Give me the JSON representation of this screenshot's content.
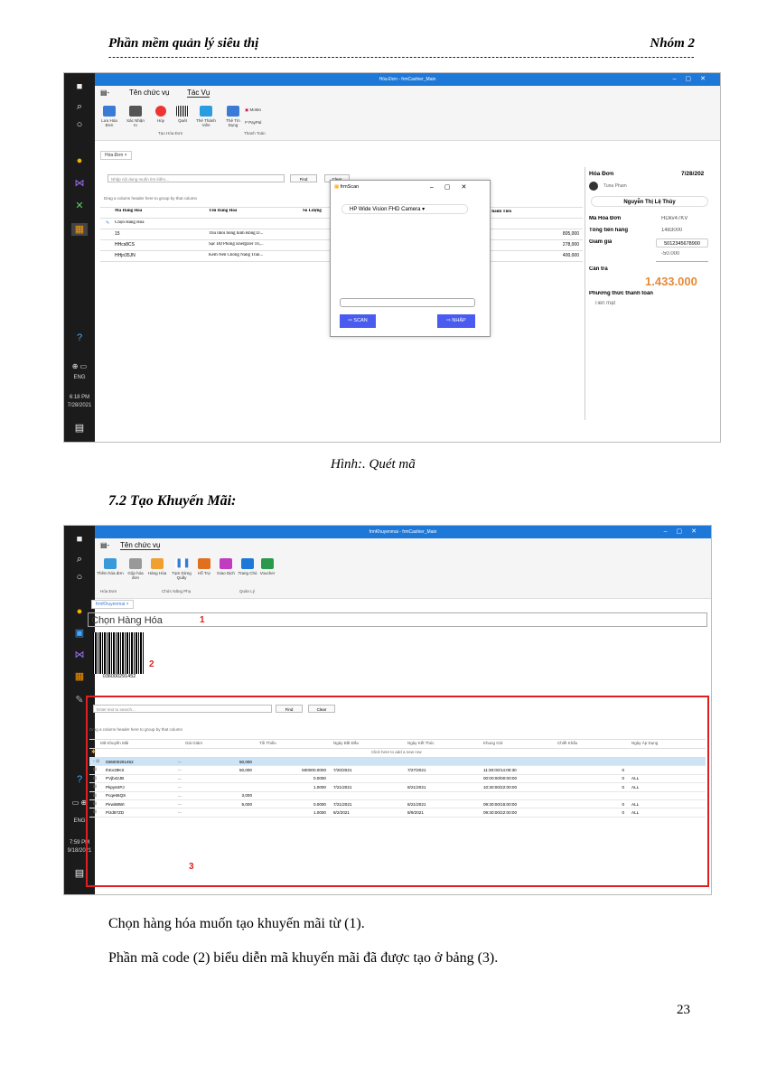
{
  "header": {
    "left": "Phần mềm quản lý siêu thị",
    "right": "Nhóm 2"
  },
  "fig1": {
    "taskbar": {
      "lang": "ENG",
      "time": "6:18 PM",
      "date": "7/28/2021"
    },
    "title": "Hóa Đơn - frmCashier_Main",
    "tabs": [
      "Tên chức vụ",
      "Tác Vụ"
    ],
    "buttons": [
      "Lưu Hóa Đơn",
      "Xác Nhận In",
      "Hủy",
      "Quét",
      "Thẻ Thành Viên",
      "Thẻ Tín Dụng",
      "MoMo",
      "PayPal"
    ],
    "groups": [
      "Tạo Hóa Đơn",
      "Thanh Toán"
    ],
    "doc_tab": "Hóa Đơn",
    "search_placeholder": "Nhập nội dung muốn tìm kiếm...",
    "find": "Find",
    "clear": "Clear",
    "group_hint": "Drag a column header here to group by that column",
    "columns": [
      "Mã Hàng Hóa",
      "Tên Hàng Hóa",
      "Số Lượng",
      "Thành Tiền"
    ],
    "rows": [
      {
        "code": "Chọn Hàng Hóa",
        "name": "",
        "total": ""
      },
      {
        "code": "15",
        "name": "Thú nhồi bông hình Rồng D...",
        "total": "805,000"
      },
      {
        "code": "HHcs8CS",
        "name": "Sạc Dự Phòng Energizer 10,...",
        "total": "278,000"
      },
      {
        "code": "HHjn35JN",
        "name": "Kem Nền Chống Nắng Tran...",
        "total": "400,000"
      }
    ],
    "scan": {
      "title": "frmScan",
      "camera": "HP Wide Vision FHD Camera",
      "scan_btn": "SCAN",
      "enter_btn": "NHẬP"
    },
    "invoice": {
      "label": "Hóa Đơn",
      "date": "7/28/202",
      "user": "Tuna Phạm",
      "customer": "Nguyễn Thị Lệ Thủy",
      "code_label": "Mã Hóa Đơn",
      "code": "HDkv47KV",
      "sum_label": "Tổng tiền hàng",
      "sum": "1483000",
      "disc_label": "Giảm giá",
      "disc_code": "5012345678900",
      "disc": "-50.000",
      "pay_label": "Cần trả",
      "pay": "1.433.000",
      "method_label": "Phương thức thanh toán",
      "method": "Tiền mặt"
    }
  },
  "caption1": "Hình:. Quét mã",
  "section": "7.2 Tạo Khuyến Mãi:",
  "fig2": {
    "taskbar": {
      "lang": "ENG",
      "time": "7:59 PM",
      "date": "9/18/2021"
    },
    "title": "frmKhuyenmai - frmCashier_Main",
    "tab": "Tên chức vụ",
    "buttons": [
      "Thêm hóa đơn",
      "Gộp hóa đơn",
      "Hàng Hóa",
      "Tạm Dừng Quầy",
      "Hỗ Trợ",
      "Giao Dịch",
      "Trang Chủ",
      "Voucher"
    ],
    "groups": [
      "Hóa Đơn",
      "Chức Năng Phụ",
      "Quản Lý"
    ],
    "doc_tab": "frmKhuyenmai",
    "combo": "Chọn Hàng Hóa",
    "barcode": "036000291452",
    "marks": [
      "1",
      "2",
      "3"
    ],
    "search_placeholder": "Enter text to search...",
    "find": "Find",
    "clear": "Clear",
    "group_hint": "Drag a column header here to group by that column",
    "columns": [
      "Mã Khuyến Mãi",
      "Giá Giảm",
      "Tối Thiểu",
      "Ngày Bắt Đầu",
      "Ngày Kết Thúc",
      "Khung Giờ",
      "Chiết Khấu",
      "Ngày Áp Dụng"
    ],
    "new_row": "Click here to add a new row",
    "rows": [
      [
        "036000291452",
        "50,000",
        "",
        "",
        "",
        "",
        "",
        ""
      ],
      [
        "IhKv29KS",
        "50,000",
        "500000.0000",
        "7/20/2021",
        "7/27/2021",
        "11:30:00/14:00:30",
        "0",
        ""
      ],
      [
        "PVjb42JB",
        "",
        "0.0000",
        "",
        "",
        "00:00:00/00:00:00",
        "0",
        "ALL"
      ],
      [
        "Pkpy64PJ",
        "",
        "1.0000",
        "7/21/2021",
        "8/21/2021",
        "10:30:00/22:00:00",
        "0",
        "ALL"
      ],
      [
        "Pcqe66QS",
        "3,000",
        "",
        "",
        "",
        "",
        "",
        ""
      ],
      [
        "Pirwi88WI",
        "9,000",
        "0.0000",
        "7/21/2021",
        "8/21/2021",
        "09:30:00/15:00:00",
        "0",
        "ALL"
      ],
      [
        "Pizd97ZD",
        "",
        "1.0000",
        "8/2/2021",
        "8/9/2021",
        "09:30:00/22:00:00",
        "0",
        "ALL"
      ]
    ]
  },
  "para1": "Chọn hàng hóa muốn tạo khuyến mãi từ (1).",
  "para2": "Phần mã code (2) biểu diễn mã khuyến mãi đã được tạo ở bảng (3).",
  "page_number": "23",
  "colors": {
    "accent": "#1e78d7",
    "scan_btn": "#4a5cf0",
    "highlight": "#e02020",
    "selected_row": "#cde3f6"
  }
}
